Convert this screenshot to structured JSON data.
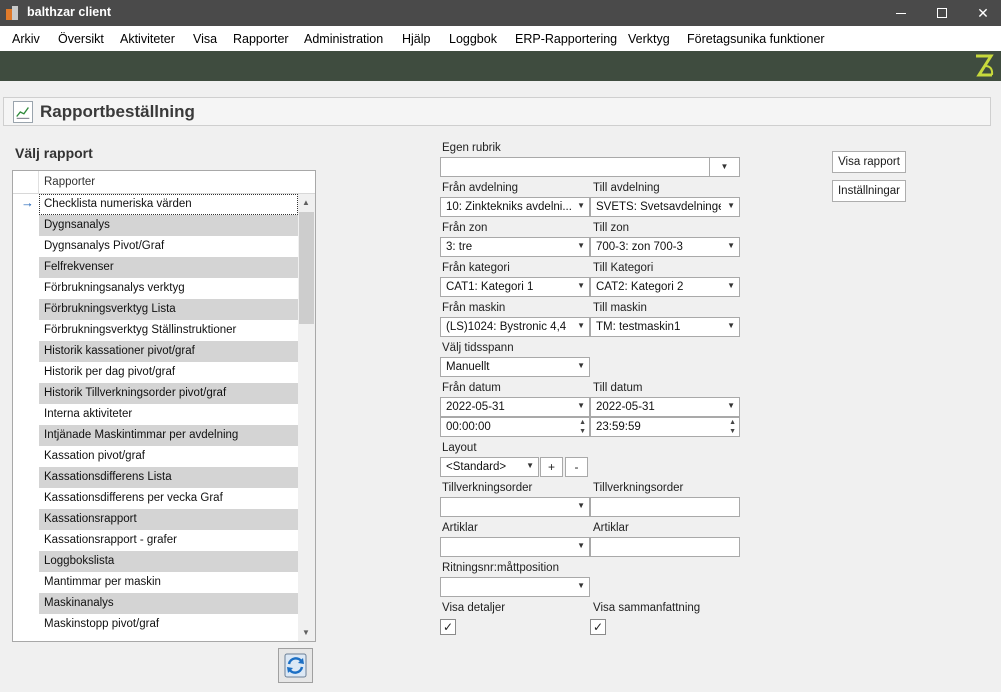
{
  "window": {
    "title": "balthzar client"
  },
  "menu": [
    "Arkiv",
    "Översikt",
    "Aktiviteter",
    "Visa",
    "Rapporter",
    "Administration",
    "Hjälp",
    "Loggbok",
    "ERP-Rapportering",
    "Verktyg",
    "Företagsunika funktioner"
  ],
  "page": {
    "title": "Rapportbeställning"
  },
  "report_list": {
    "section_label": "Välj rapport",
    "column_header": "Rapporter",
    "selected_index": 0,
    "items": [
      "Checklista numeriska värden",
      "Dygnsanalys",
      "Dygnsanalys Pivot/Graf",
      "Felfrekvenser",
      "Förbrukningsanalys verktyg",
      "Förbrukningsverktyg Lista",
      "Förbrukningsverktyg Ställinstruktioner",
      "Historik kassationer pivot/graf",
      "Historik per dag pivot/graf",
      "Historik Tillverkningsorder pivot/graf",
      "Interna aktiviteter",
      "Intjänade Maskintimmar per avdelning",
      "Kassation pivot/graf",
      "Kassationsdifferens Lista",
      "Kassationsdifferens per vecka Graf",
      "Kassationsrapport",
      "Kassationsrapport - grafer",
      "Loggbokslista",
      "Mantimmar per maskin",
      "Maskinanalys",
      "Maskinstopp pivot/graf"
    ]
  },
  "form": {
    "egen_rubrik": {
      "label": "Egen rubrik",
      "value": ""
    },
    "fran_avdelning": {
      "label": "Från avdelning",
      "value": "10: Zinktekniks avdelni..."
    },
    "till_avdelning": {
      "label": "Till avdelning",
      "value": "SVETS: Svetsavdelningen"
    },
    "fran_zon": {
      "label": "Från zon",
      "value": "3: tre"
    },
    "till_zon": {
      "label": "Till zon",
      "value": "700-3: zon 700-3"
    },
    "fran_kategori": {
      "label": "Från kategori",
      "value": "CAT1: Kategori 1"
    },
    "till_kategori": {
      "label": "Till Kategori",
      "value": "CAT2: Kategori 2"
    },
    "fran_maskin": {
      "label": "Från maskin",
      "value": "(LS)1024: Bystronic 4,4"
    },
    "till_maskin": {
      "label": "Till maskin",
      "value": "TM: testmaskin1"
    },
    "tidsspann": {
      "label": "Välj tidsspann",
      "value": "Manuellt"
    },
    "fran_datum": {
      "label": "Från datum",
      "date": "2022-05-31",
      "time": "00:00:00"
    },
    "till_datum": {
      "label": "Till datum",
      "date": "2022-05-31",
      "time": "23:59:59"
    },
    "layout": {
      "label": "Layout",
      "value": "<Standard>",
      "add_label": "+",
      "remove_label": "-"
    },
    "tillverkningsorder_fran": {
      "label": "Tillverkningsorder",
      "value": ""
    },
    "tillverkningsorder_till": {
      "label": "Tillverkningsorder",
      "value": ""
    },
    "artiklar_fran": {
      "label": "Artiklar",
      "value": ""
    },
    "artiklar_till": {
      "label": "Artiklar",
      "value": ""
    },
    "ritningsnr": {
      "label": "Ritningsnr:måttposition",
      "value": ""
    },
    "visa_detaljer": {
      "label": "Visa detaljer",
      "checked": true
    },
    "visa_sammanfattning": {
      "label": "Visa sammanfattning",
      "checked": true
    }
  },
  "buttons": {
    "visa_rapport": "Visa rapport",
    "installningar": "Inställningar"
  },
  "colors": {
    "titlebar": "#4a4a4a",
    "toolbar": "#3f4c3f",
    "alt_row": "#d4d4d4",
    "logo": "#c7d93c"
  }
}
